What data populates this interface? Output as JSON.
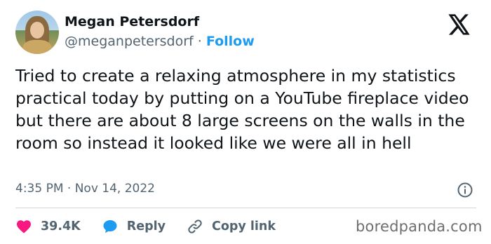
{
  "author": {
    "name": "Megan Petersdorf",
    "handle": "@meganpetersdorf",
    "separator": "·",
    "follow_label": "Follow"
  },
  "tweet": {
    "text": "Tried to create a relaxing atmosphere in my statistics practical today by putting on a YouTube fireplace video but there are about 8 large screens on the walls in the room so instead it looked like we were all in hell",
    "timestamp": "4:35 PM · Nov 14, 2022"
  },
  "actions": {
    "likes": "39.4K",
    "reply_label": "Reply",
    "copy_link_label": "Copy link"
  },
  "watermark": "boredpanda.com",
  "icons": {
    "brand": "x-logo-icon",
    "info": "info-icon",
    "like": "heart-icon",
    "reply": "speech-bubble-icon",
    "copy": "link-icon"
  },
  "colors": {
    "follow": "#1d9bf0",
    "heart": "#f91880",
    "reply": "#1d9bf0",
    "muted": "#536471"
  }
}
